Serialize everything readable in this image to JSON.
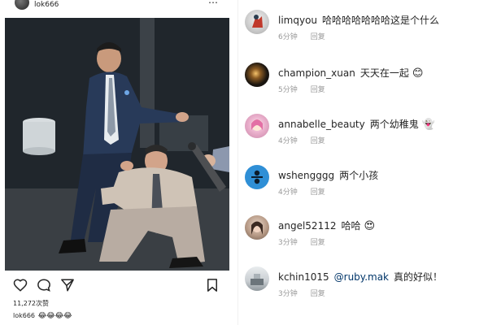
{
  "post": {
    "username": "lok666",
    "more_icon": "⋯",
    "likes": "11,272次赞",
    "caption_user": "lok666",
    "caption_emojis": "😂😂😂😂"
  },
  "comments": [
    {
      "user": "limqyou",
      "text": "哈哈哈哈哈哈哈这是个什么",
      "time": "6分钟",
      "reply": "回复",
      "emoji": "",
      "mention": "",
      "avatar_color": "#d9d9d9"
    },
    {
      "user": "champion_xuan",
      "text": "天天在一起",
      "time": "5分钟",
      "reply": "回复",
      "emoji": "😊",
      "mention": "",
      "avatar_color": "#1e1a14"
    },
    {
      "user": "annabelle_beauty",
      "text": "两个幼稚鬼",
      "time": "4分钟",
      "reply": "回复",
      "emoji": "👻",
      "mention": "",
      "avatar_color": "#e7a9c8"
    },
    {
      "user": "wshengggg",
      "text": "两个小孩",
      "time": "4分钟",
      "reply": "回复",
      "emoji": "",
      "mention": "",
      "avatar_color": "#3b8fd1"
    },
    {
      "user": "angel52112",
      "text": "哈哈",
      "time": "3分钟",
      "reply": "回复",
      "emoji": "😍",
      "mention": "",
      "avatar_color": "#c9b5a6"
    },
    {
      "user": "kchin1015",
      "text": "真的好似！",
      "time": "3分钟",
      "reply": "回复",
      "emoji": "",
      "mention": "@ruby.mak",
      "avatar_color": "#cfd3d6"
    }
  ],
  "icons": {
    "like": "heart-icon",
    "comment": "comment-icon",
    "share": "share-icon",
    "save": "bookmark-icon"
  }
}
